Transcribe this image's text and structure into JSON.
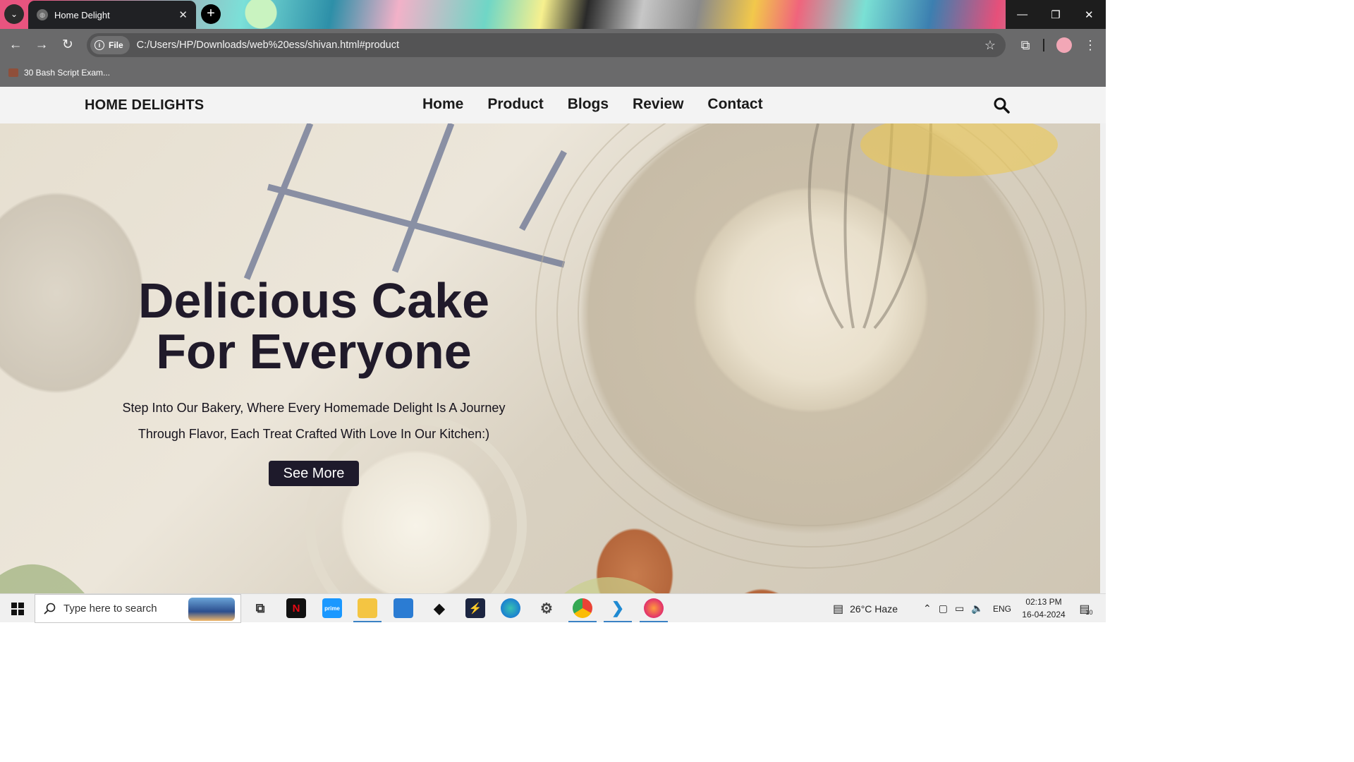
{
  "browser": {
    "tab_title": "Home Delight",
    "tab_close": "✕",
    "new_tab": "+",
    "site_chip": "File",
    "url": "C:/Users/HP/Downloads/web%20ess/shivan.html#product",
    "bookmark": "30 Bash Script Exam...",
    "window_controls": [
      "—",
      "❐",
      "✕"
    ]
  },
  "site": {
    "logo": "HOME DELIGHTS",
    "nav": [
      "Home",
      "Product",
      "Blogs",
      "Review",
      "Contact"
    ]
  },
  "hero": {
    "title_line1": "Delicious Cake",
    "title_line2": "For Everyone",
    "subtitle_line1": "Step Into Our Bakery, Where Every Homemade Delight Is A Journey",
    "subtitle_line2": "Through Flavor, Each Treat Crafted With Love In Our Kitchen:)",
    "button": "See More"
  },
  "taskbar": {
    "search_placeholder": "Type here to search",
    "weather": "26°C  Haze",
    "language": "ENG",
    "time": "02:13 PM",
    "date": "16-04-2024",
    "notifications": "10",
    "apps": [
      "netflix",
      "prime-video",
      "file-explorer",
      "microsoft-store",
      "dropbox",
      "powershell",
      "edge",
      "settings",
      "chrome",
      "vscode",
      "firefox"
    ]
  },
  "colors": {
    "browser_chrome": "#6a6a6b",
    "navbar_bg": "#f3f3f3",
    "hero_text": "#201a2a",
    "button_bg": "#1e1a2b"
  }
}
